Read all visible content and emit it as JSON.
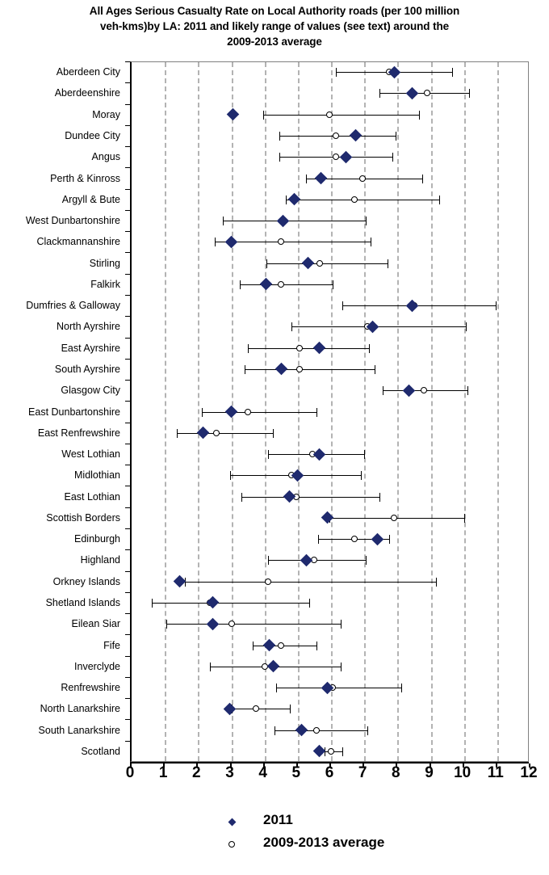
{
  "chart_title": "All Ages Serious Casualty Rate on Local Authority roads (per 100 million veh-kms)by LA: 2011 and likely range of values (see text) around the 2009-2013 average",
  "title_lines": [
    "All Ages Serious Casualty Rate on Local Authority roads (per 100 million",
    "veh-kms)by LA: 2011 and likely range of values (see text) around the",
    "2009-2013 average"
  ],
  "legend": {
    "items": [
      {
        "label": "2011",
        "marker": "diamond",
        "color": "#1F2A6E"
      },
      {
        "label": "2009-2013 average",
        "marker": "circle",
        "color": "#FFFFFF"
      }
    ]
  },
  "axis": {
    "x_ticks": [
      0,
      1,
      2,
      3,
      4,
      5,
      6,
      7,
      8,
      9,
      10,
      11,
      12
    ],
    "x_tick_labels": [
      "0",
      "1",
      "2",
      "3",
      "4",
      "5",
      "6",
      "7",
      "8",
      "9",
      "10",
      "11",
      "12"
    ],
    "x_min": 0,
    "x_max": 12,
    "grid": true
  },
  "chart_data": {
    "type": "scatter",
    "title": "All Ages Serious Casualty Rate on Local Authority roads (per 100 million veh-kms)by LA: 2011 and likely range of values (see text) around the 2009-2013 average",
    "xlabel": "",
    "ylabel": "",
    "xlim": [
      0,
      12
    ],
    "grid": true,
    "legend_position": "bottom",
    "orientation": "horizontal",
    "categories": [
      "Aberdeen City",
      "Aberdeenshire",
      "Moray",
      "Dundee City",
      "Angus",
      "Perth & Kinross",
      "Argyll & Bute",
      "West Dunbartonshire",
      "Clackmannanshire",
      "Stirling",
      "Falkirk",
      "Dumfries & Galloway",
      "North Ayrshire",
      "East Ayrshire",
      "South Ayrshire",
      "Glasgow City",
      "East Dunbartonshire",
      "East Renfrewshire",
      "West Lothian",
      "Midlothian",
      "East Lothian",
      "Scottish Borders",
      "Edinburgh",
      "Highland",
      "Orkney Islands",
      "Shetland Islands",
      "Eilean Siar",
      "Fife",
      "Inverclyde",
      "Renfrewshire",
      "North Lanarkshire",
      "South Lanarkshire",
      "Scotland"
    ],
    "series": [
      {
        "name": "2011",
        "marker": "diamond",
        "color": "#1F2A6E",
        "values": [
          7.95,
          8.5,
          3.1,
          6.8,
          6.5,
          5.75,
          4.95,
          4.6,
          3.05,
          5.35,
          4.1,
          8.5,
          7.3,
          5.7,
          4.55,
          8.4,
          3.05,
          2.2,
          5.7,
          5.05,
          4.8,
          5.95,
          7.45,
          5.3,
          1.5,
          2.5,
          2.5,
          4.2,
          4.3,
          5.95,
          3.0,
          5.15,
          5.7
        ]
      },
      {
        "name": "2009-2013 average",
        "marker": "circle",
        "color": "#FFFFFF",
        "values": [
          7.8,
          8.95,
          6.0,
          6.2,
          6.2,
          7.0,
          6.75,
          4.6,
          4.55,
          5.7,
          4.55,
          8.55,
          7.15,
          5.1,
          5.1,
          8.85,
          3.55,
          2.6,
          5.5,
          4.85,
          5.0,
          7.95,
          6.75,
          5.55,
          4.15,
          2.4,
          3.05,
          4.55,
          4.05,
          6.1,
          3.8,
          5.6,
          6.05
        ]
      }
    ],
    "ranges": {
      "name": "likely range of values around the 2009-2013 average",
      "low": [
        6.2,
        7.5,
        4.0,
        4.5,
        4.5,
        5.3,
        4.7,
        2.8,
        2.55,
        4.1,
        3.3,
        6.4,
        4.85,
        3.55,
        3.45,
        7.6,
        2.15,
        1.4,
        4.15,
        3.0,
        3.35,
        6.0,
        5.65,
        4.15,
        1.65,
        0.65,
        1.1,
        3.7,
        2.4,
        4.4,
        3.05,
        4.35,
        5.85
      ],
      "high": [
        9.7,
        10.2,
        8.7,
        8.0,
        7.9,
        8.8,
        9.3,
        7.1,
        7.25,
        7.75,
        6.1,
        11.0,
        10.1,
        7.2,
        7.35,
        10.15,
        5.6,
        4.3,
        7.05,
        6.95,
        7.5,
        10.05,
        7.8,
        7.1,
        9.2,
        5.4,
        6.35,
        5.6,
        6.35,
        8.15,
        4.8,
        7.15,
        6.4
      ]
    }
  }
}
